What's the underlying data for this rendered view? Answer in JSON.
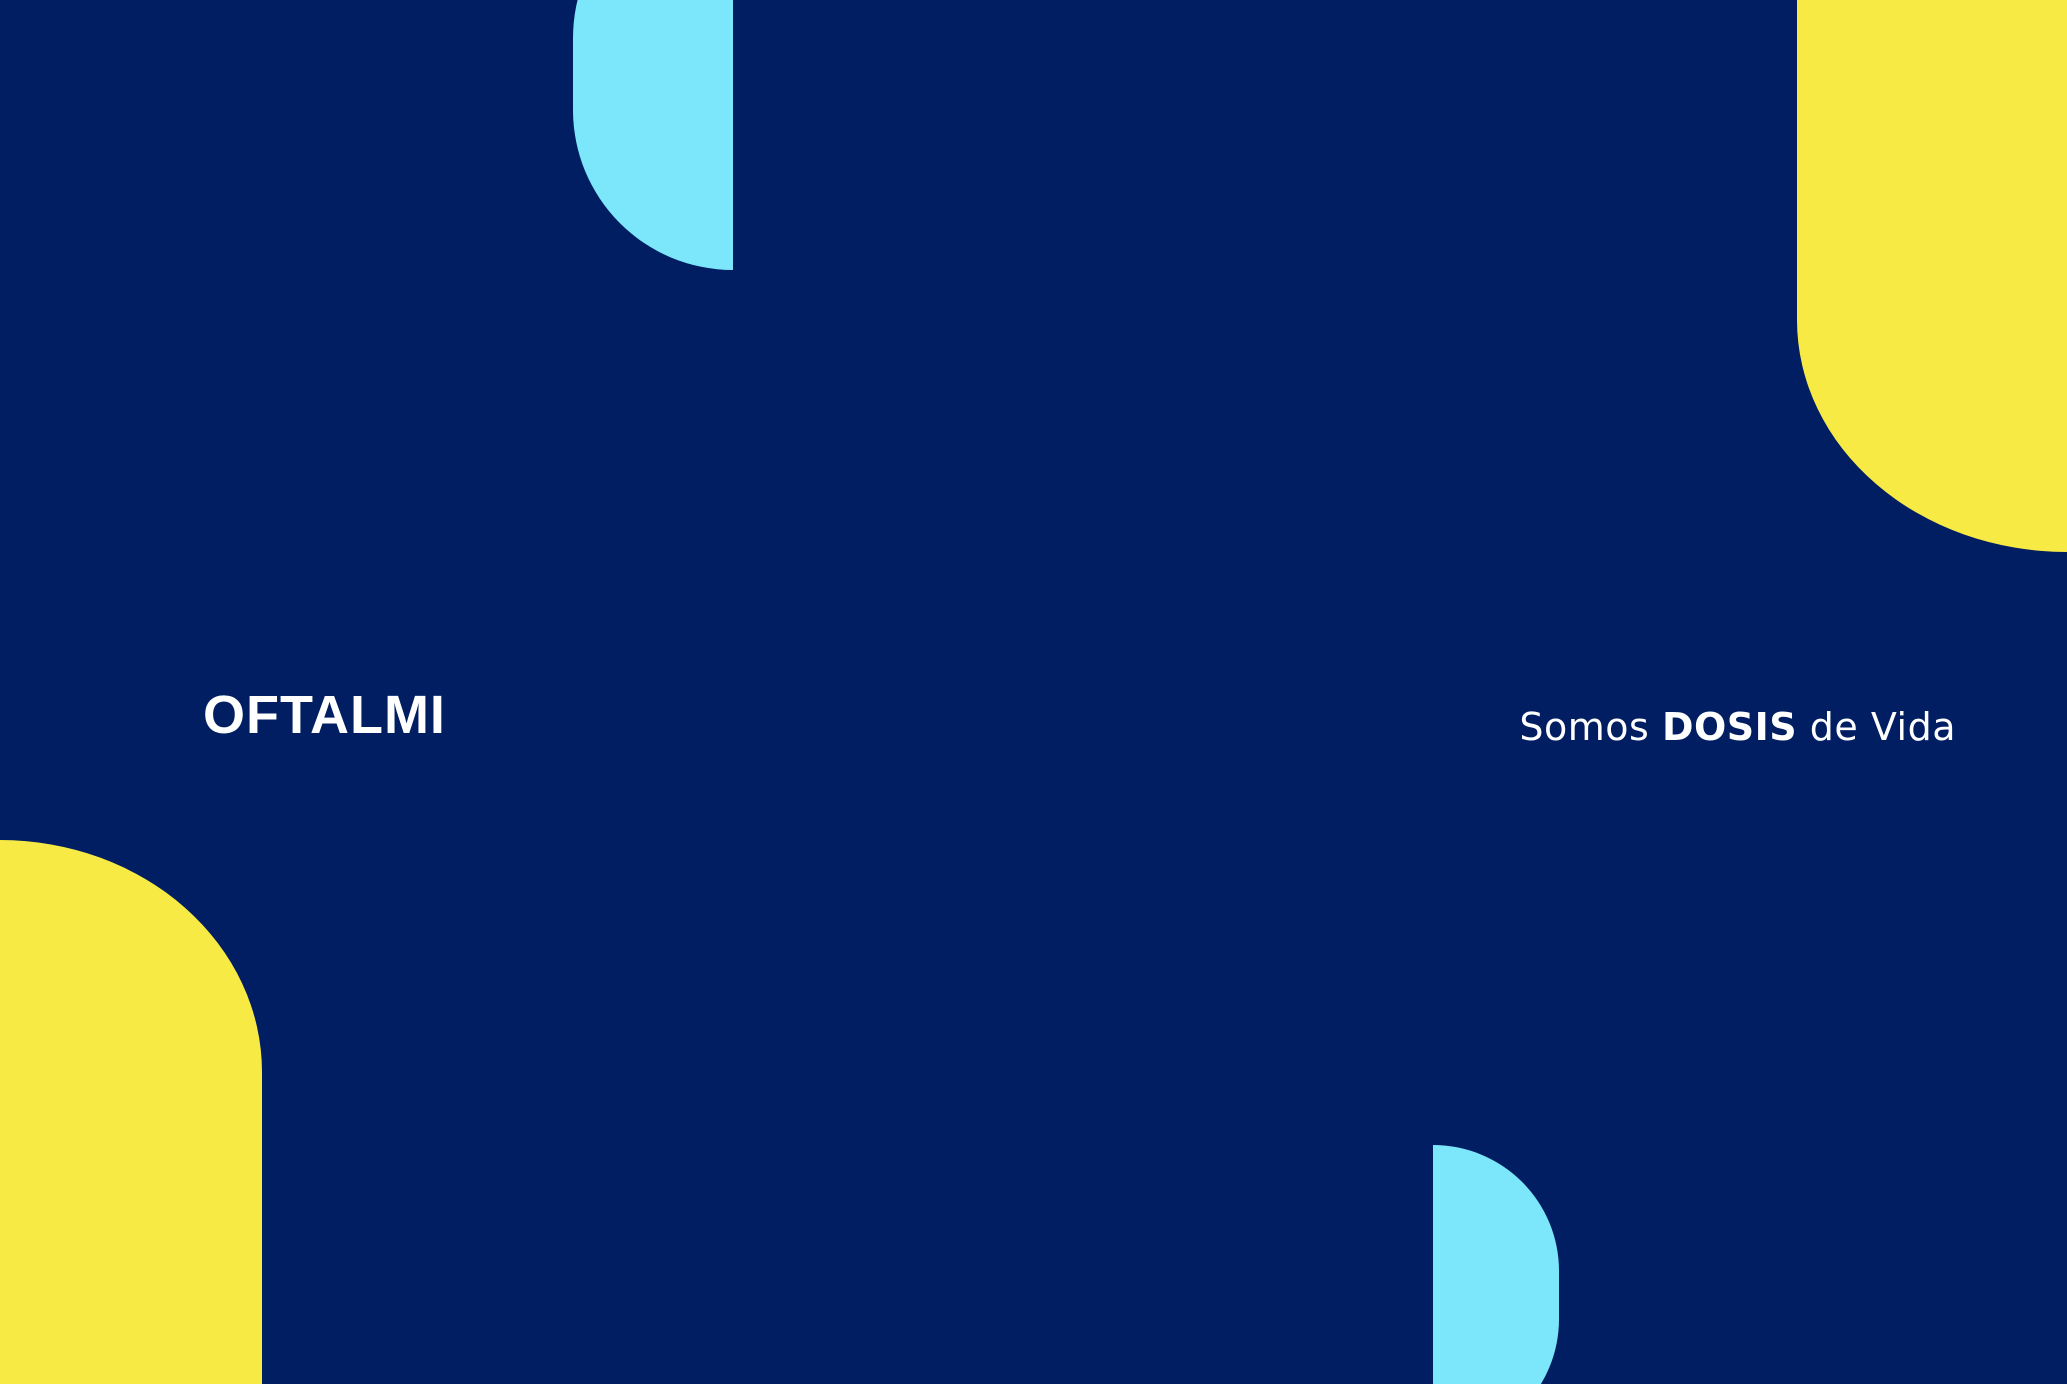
{
  "colors": {
    "background": "#001e61",
    "yellow": "#f8ea45",
    "cyan": "#7ce6fb",
    "text": "#ffffff"
  },
  "brand": {
    "name": "OFTALMI"
  },
  "tagline": {
    "prefix": "Somos",
    "emphasis": "DOSIS",
    "suffix": "de Vida"
  }
}
